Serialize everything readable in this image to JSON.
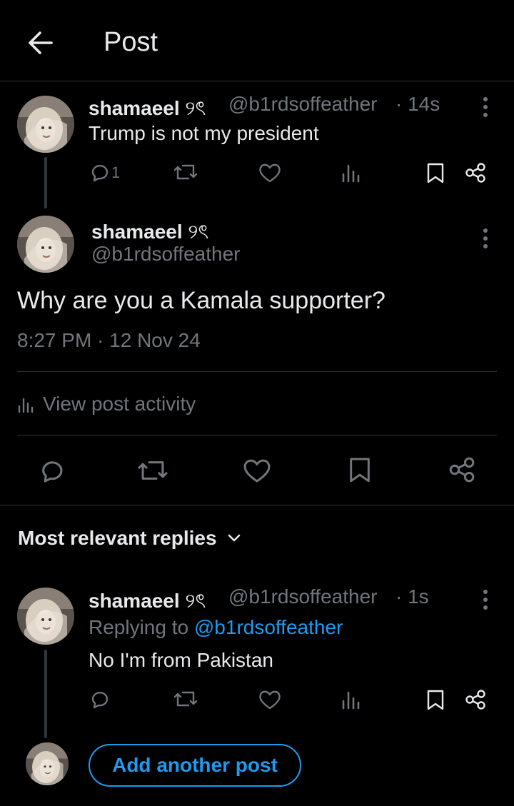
{
  "header": {
    "title": "Post"
  },
  "parent_post": {
    "display_name": "shamaeel",
    "name_glyph": "୨ৎ",
    "handle": "@b1rdsoffeather",
    "time": "· 14s",
    "text": "Trump is not my president",
    "reply_count": "1"
  },
  "main_post": {
    "display_name": "shamaeel",
    "name_glyph": "୨ৎ",
    "handle": "@b1rdsoffeather",
    "text": "Why are you a Kamala supporter?",
    "timestamp": "8:27 PM · 12 Nov 24",
    "activity_label": "View post activity"
  },
  "replies": {
    "sort_label": "Most relevant replies",
    "reply": {
      "display_name": "shamaeel",
      "name_glyph": "୨ৎ",
      "handle": "@b1rdsoffeather",
      "time": "· 1s",
      "replying_prefix": "Replying to",
      "replying_handle": "@b1rdsoffeather",
      "text": "No I'm from Pakistan"
    },
    "add_button": "Add another post"
  },
  "colors": {
    "background": "#000000",
    "text": "#e7e9ea",
    "muted": "#71767b",
    "accent": "#1d9bf0",
    "divider": "#2f3336"
  }
}
